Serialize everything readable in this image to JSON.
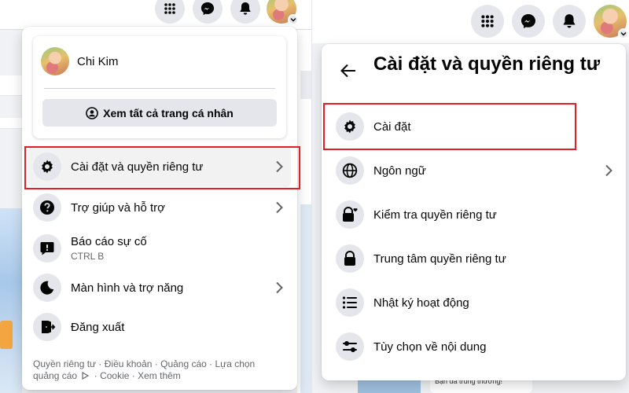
{
  "left_menu": {
    "profile": {
      "name": "Chi Kim",
      "see_all_label": "Xem tất cả trang cá nhân"
    },
    "items": [
      {
        "label": "Cài đặt và quyền riêng tư",
        "icon": "gear-icon",
        "chevron": true,
        "highlighted": true
      },
      {
        "label": "Trợ giúp và hỗ trợ",
        "icon": "question-icon",
        "chevron": true
      },
      {
        "label": "Báo cáo sự cố",
        "sublabel": "CTRL B",
        "icon": "feedback-icon",
        "chevron": false
      },
      {
        "label": "Màn hình và trợ năng",
        "icon": "moon-icon",
        "chevron": true
      },
      {
        "label": "Đăng xuất",
        "icon": "logout-icon",
        "chevron": false
      }
    ],
    "footer": {
      "line1": "Quyền riêng tư · Điều khoản · Quảng cáo · Lựa chọn",
      "line2_pre": "quảng cáo",
      "line2_post": "· Cookie · Xem thêm"
    }
  },
  "settings_menu": {
    "title": "Cài đặt và quyền riêng tư",
    "items": [
      {
        "label": "Cài đặt",
        "icon": "gear-icon",
        "chevron": false,
        "highlighted": true
      },
      {
        "label": "Ngôn ngữ",
        "icon": "globe-icon",
        "chevron": true
      },
      {
        "label": "Kiểm tra quyền riêng tư",
        "icon": "lock-heart-icon",
        "chevron": false
      },
      {
        "label": "Trung tâm quyền riêng tư",
        "icon": "lock-icon",
        "chevron": false
      },
      {
        "label": "Nhật ký hoạt động",
        "icon": "list-icon",
        "chevron": false
      },
      {
        "label": "Tùy chọn về nội dung",
        "icon": "sliders-icon",
        "chevron": false
      }
    ]
  },
  "background": {
    "ad_text": "Bạn đã trúng thưởng!"
  },
  "colors": {
    "highlight_box": "#e41e26",
    "icon_bg": "#e4e6eb",
    "page_bg": "#f0f2f5",
    "secondary_text": "#65676b"
  }
}
